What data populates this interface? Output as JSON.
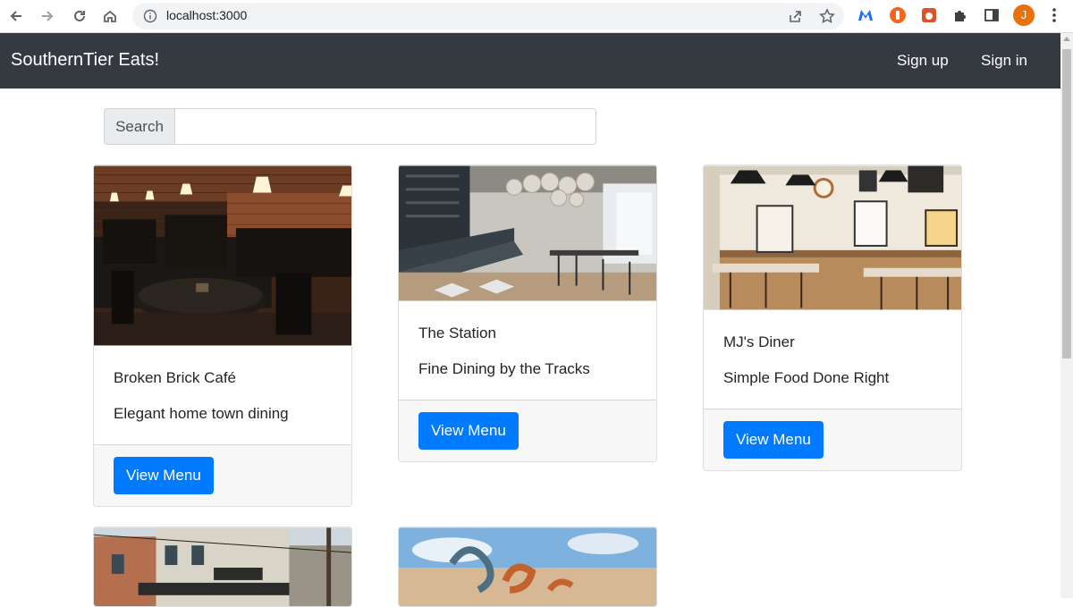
{
  "browser": {
    "url": "localhost:3000",
    "profile_initial": "J",
    "accent": "#e8710a"
  },
  "navbar": {
    "brand": "SouthernTier Eats!",
    "links": [
      "Sign up",
      "Sign in"
    ],
    "background": "#343a40"
  },
  "search": {
    "label": "Search",
    "value": ""
  },
  "restaurants": [
    {
      "name": "Broken Brick Café",
      "tagline": "Elegant home town dining",
      "button": "View Menu"
    },
    {
      "name": "The Station",
      "tagline": "Fine Dining by the Tracks",
      "button": "View Menu"
    },
    {
      "name": "MJ's Diner",
      "tagline": "Simple Food Done Right",
      "button": "View Menu"
    }
  ],
  "colors": {
    "primary_button": "#007bff"
  }
}
